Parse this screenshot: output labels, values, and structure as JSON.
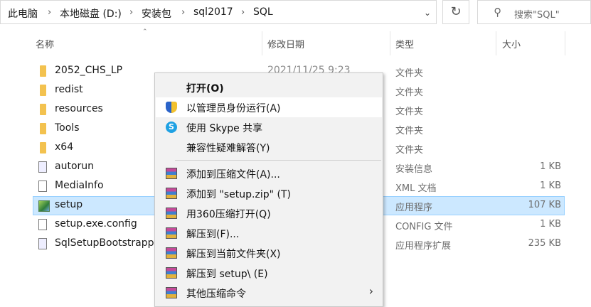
{
  "breadcrumb": [
    "此电脑",
    "本地磁盘 (D:)",
    "安装包",
    "sql2017",
    "SQL"
  ],
  "search": {
    "placeholder": "搜索\"SQL\""
  },
  "columns": {
    "name": "名称",
    "date": "修改日期",
    "type": "类型",
    "size": "大小"
  },
  "files": [
    {
      "name": "2052_CHS_LP",
      "date": "2021/11/25 9:23",
      "type": "文件夹",
      "size": "",
      "icon": "folder-icon"
    },
    {
      "name": "redist",
      "date": "",
      "type": "文件夹",
      "size": "",
      "icon": "folder-icon"
    },
    {
      "name": "resources",
      "date": "",
      "type": "文件夹",
      "size": "",
      "icon": "folder-icon"
    },
    {
      "name": "Tools",
      "date": "",
      "type": "文件夹",
      "size": "",
      "icon": "folder-icon"
    },
    {
      "name": "x64",
      "date": "",
      "type": "文件夹",
      "size": "",
      "icon": "folder-icon"
    },
    {
      "name": "autorun",
      "date": "",
      "type": "安装信息",
      "size": "1 KB",
      "icon": "inf-file-icon"
    },
    {
      "name": "MediaInfo",
      "date": "",
      "type": "XML 文档",
      "size": "1 KB",
      "icon": "file-icon"
    },
    {
      "name": "setup",
      "date": "",
      "type": "应用程序",
      "size": "107 KB",
      "icon": "setup-exe-icon",
      "selected": true
    },
    {
      "name": "setup.exe.config",
      "date": "",
      "type": "CONFIG 文件",
      "size": "1 KB",
      "icon": "file-icon"
    },
    {
      "name": "SqlSetupBootstrapp",
      "date": "",
      "type": "应用程序扩展",
      "size": "235 KB",
      "icon": "dll-file-icon"
    }
  ],
  "context_menu": {
    "items": [
      {
        "label": "打开(O)",
        "bold": true,
        "icon": ""
      },
      {
        "label": "以管理员身份运行(A)",
        "icon": "uac-shield-icon",
        "highlighted": true
      },
      {
        "label": "使用 Skype 共享",
        "icon": "skype-icon"
      },
      {
        "label": "兼容性疑难解答(Y)",
        "icon": ""
      },
      {
        "label": "添加到压缩文件(A)...",
        "icon": "archive-icon"
      },
      {
        "label": "添加到 \"setup.zip\" (T)",
        "icon": "archive-icon"
      },
      {
        "label": "用360压缩打开(Q)",
        "icon": "archive-icon"
      },
      {
        "label": "解压到(F)...",
        "icon": "archive-icon"
      },
      {
        "label": "解压到当前文件夹(X)",
        "icon": "archive-icon"
      },
      {
        "label": "解压到 setup\\ (E)",
        "icon": "archive-icon"
      },
      {
        "label": "其他压缩命令",
        "icon": "archive-icon",
        "submenu": true
      }
    ]
  },
  "colors": {
    "selection": "#cce8ff",
    "folder": "#f3c24f",
    "menu_bg": "#f2f2f2"
  }
}
